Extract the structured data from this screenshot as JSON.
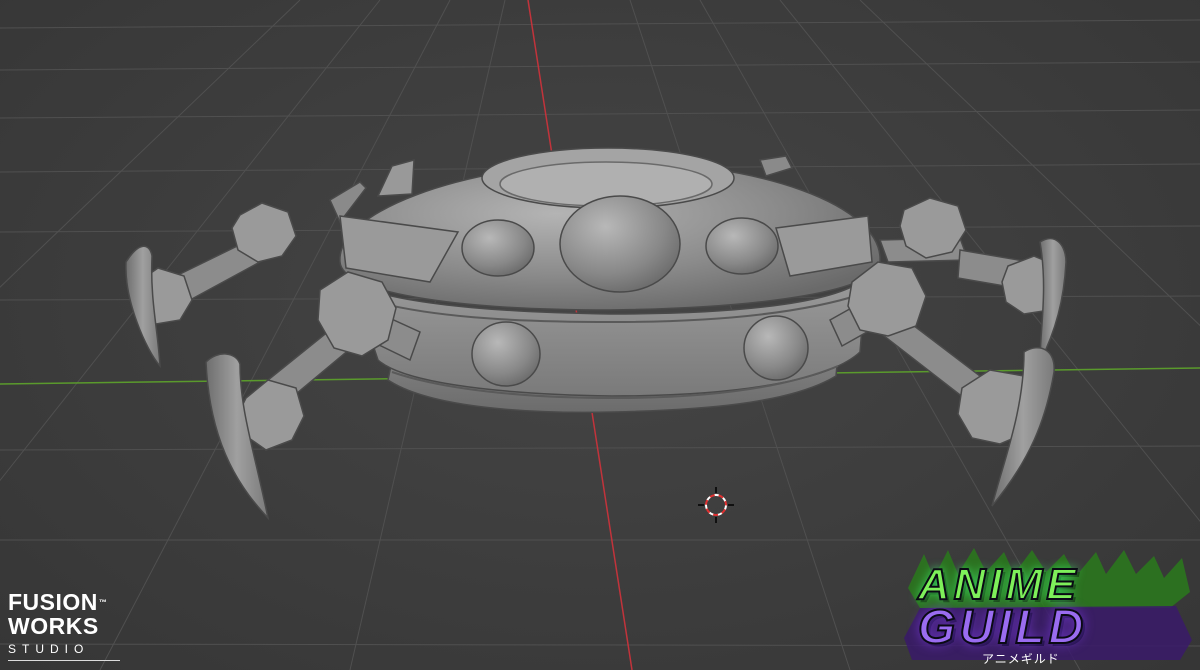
{
  "app": {
    "view": "3D viewport",
    "mode": "solid shading"
  },
  "scene": {
    "object": "spider-ufo model",
    "grid_color": "#505050",
    "x_axis_color": "#c2333b",
    "y_axis_color": "#5a9a2c",
    "model_color": "#8c8c8c"
  },
  "branding": {
    "studio": {
      "line1": "FUSION",
      "tm": "™",
      "line2": "WORKS",
      "line3": "STUDIO"
    },
    "game_logo": {
      "line1": "ANIME",
      "line2": "GUILD",
      "kana": "アニメギルド"
    }
  }
}
